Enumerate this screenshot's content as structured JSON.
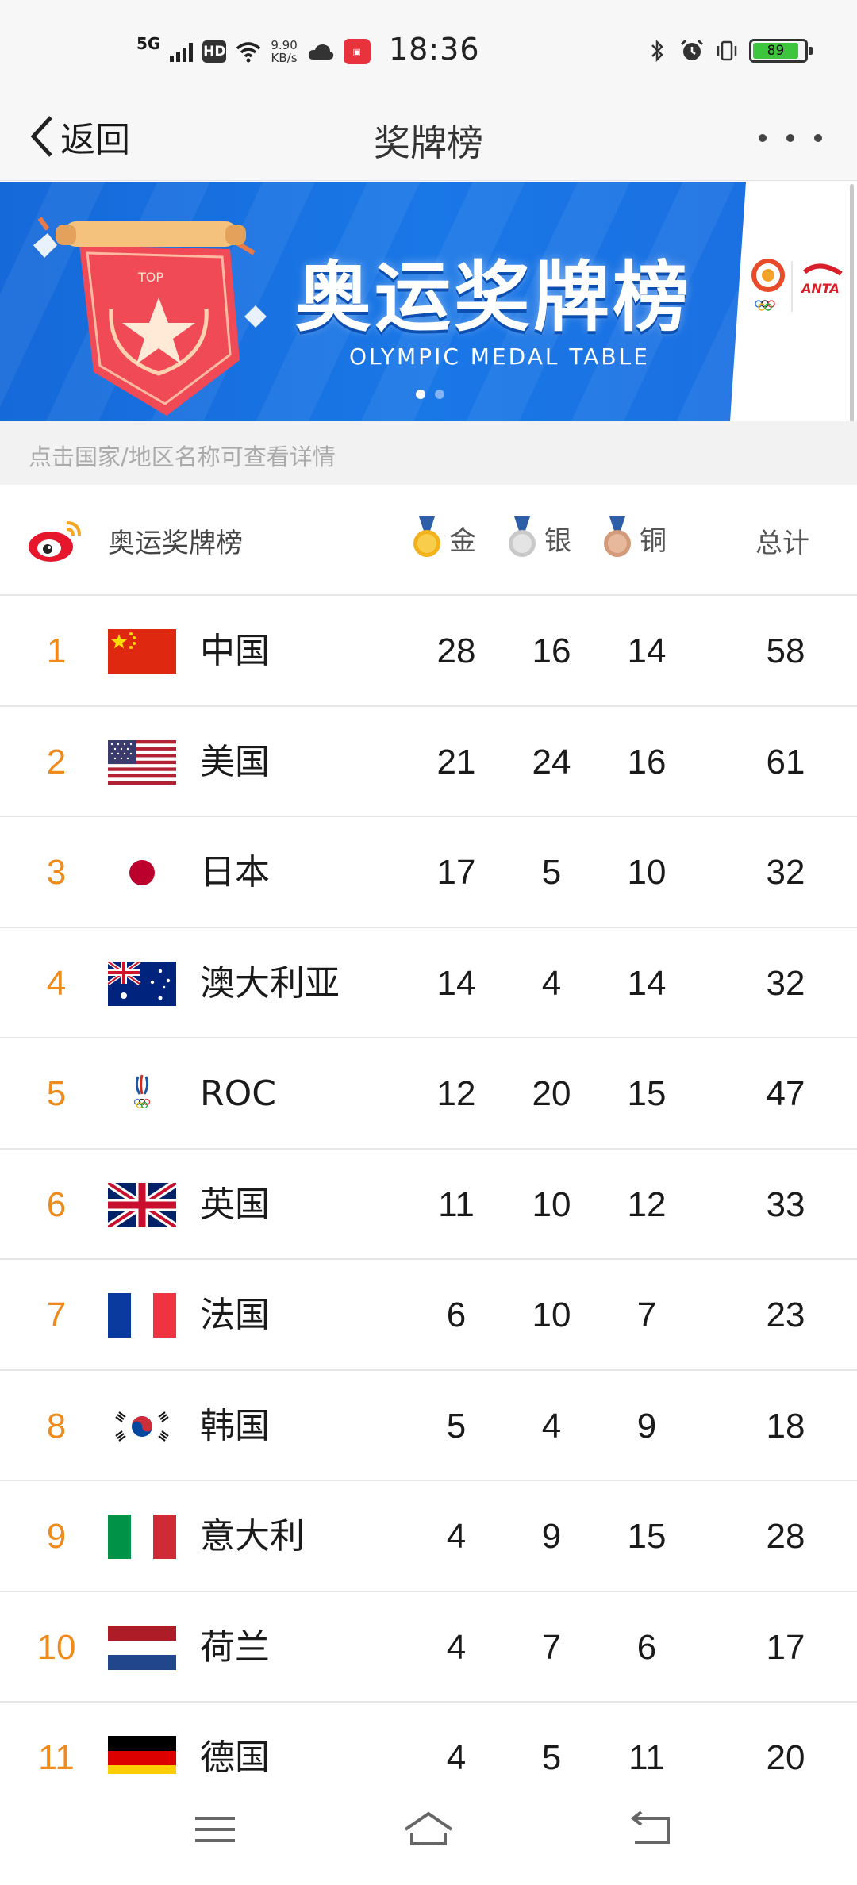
{
  "status_bar": {
    "network": "5G",
    "hd": "HD",
    "speed_value": "9.90",
    "speed_unit": "KB/s",
    "time": "18:36",
    "battery": "89"
  },
  "nav": {
    "back_label": "返回",
    "title": "奖牌榜"
  },
  "banner": {
    "title": "奥运奖牌榜",
    "subtitle": "OLYMPIC  MEDAL TABLE",
    "scroll_tag": "TOP",
    "sponsor_brand": "ANTA"
  },
  "hint": "点击国家/地区名称可查看详情",
  "table": {
    "title": "奥运奖牌榜",
    "gold_label": "金",
    "silver_label": "银",
    "bronze_label": "铜",
    "total_label": "总计",
    "rows": [
      {
        "rank": "1",
        "country": "中国",
        "gold": "28",
        "silver": "16",
        "bronze": "14",
        "total": "58",
        "flag": "china-flag"
      },
      {
        "rank": "2",
        "country": "美国",
        "gold": "21",
        "silver": "24",
        "bronze": "16",
        "total": "61",
        "flag": "usa-flag"
      },
      {
        "rank": "3",
        "country": "日本",
        "gold": "17",
        "silver": "5",
        "bronze": "10",
        "total": "32",
        "flag": "japan-flag"
      },
      {
        "rank": "4",
        "country": "澳大利亚",
        "gold": "14",
        "silver": "4",
        "bronze": "14",
        "total": "32",
        "flag": "australia-flag"
      },
      {
        "rank": "5",
        "country": "ROC",
        "gold": "12",
        "silver": "20",
        "bronze": "15",
        "total": "47",
        "flag": "roc-emblem"
      },
      {
        "rank": "6",
        "country": "英国",
        "gold": "11",
        "silver": "10",
        "bronze": "12",
        "total": "33",
        "flag": "uk-flag"
      },
      {
        "rank": "7",
        "country": "法国",
        "gold": "6",
        "silver": "10",
        "bronze": "7",
        "total": "23",
        "flag": "france-flag"
      },
      {
        "rank": "8",
        "country": "韩国",
        "gold": "5",
        "silver": "4",
        "bronze": "9",
        "total": "18",
        "flag": "korea-flag"
      },
      {
        "rank": "9",
        "country": "意大利",
        "gold": "4",
        "silver": "9",
        "bronze": "15",
        "total": "28",
        "flag": "italy-flag"
      },
      {
        "rank": "10",
        "country": "荷兰",
        "gold": "4",
        "silver": "7",
        "bronze": "6",
        "total": "17",
        "flag": "netherlands-flag"
      },
      {
        "rank": "11",
        "country": "德国",
        "gold": "4",
        "silver": "5",
        "bronze": "11",
        "total": "20",
        "flag": "germany-flag"
      }
    ]
  },
  "colors": {
    "rank": "#ef8a1c",
    "banner_blue": "#1a77e6",
    "gold": "#f2b21b",
    "silver": "#c9c9c9",
    "bronze": "#d39a7a"
  },
  "icons": {
    "bottom_nav": [
      "menu-icon",
      "home-icon",
      "back-icon"
    ]
  }
}
